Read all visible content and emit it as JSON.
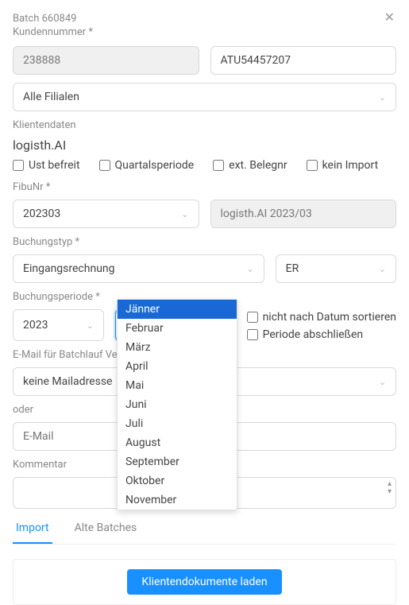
{
  "header": {
    "batch": "Batch 660849",
    "kundennummer_label": "Kundennummer *"
  },
  "close_icon": "✕",
  "kundennummer_value": "238888",
  "uid_value": "ATU54457207",
  "filiale_value": "Alle Filialen",
  "klientendaten_label": "Klientendaten",
  "klientendaten_value": "logisth.AI",
  "checks": {
    "ust_befreit": "Ust befreit",
    "quartalsperiode": "Quartalsperiode",
    "ext_belegnr": "ext. Belegnr",
    "kein_import": "kein Import"
  },
  "fibunr_label": "FibuNr *",
  "fibunr_value": "202303",
  "fibuname_value": "logisth.AI 2023/03",
  "buchungstyp_label": "Buchungstyp *",
  "buchungstyp_value": "Eingangsrechnung",
  "buchungstyp_code": "ER",
  "buchungsperiode_label": "Buchungsperiode *",
  "year_value": "2023",
  "month_value": "Jänner",
  "months": [
    "Jänner",
    "Februar",
    "März",
    "April",
    "Mai",
    "Juni",
    "Juli",
    "August",
    "September",
    "Oktober",
    "November"
  ],
  "month_selected_index": 0,
  "side_checks": {
    "nicht_sortieren": "nicht nach Datum sortieren",
    "periode_abschliessen": "Periode abschließen"
  },
  "email_label": "E-Mail für Batchlauf Verständigung",
  "email_select_value": "keine Mailadresse",
  "oder_label": "oder",
  "email_placeholder": "E-Mail",
  "kommentar_label": "Kommentar",
  "tabs": {
    "import": "Import",
    "alte_batches": "Alte Batches"
  },
  "load_button": "Klientendokumente laden"
}
